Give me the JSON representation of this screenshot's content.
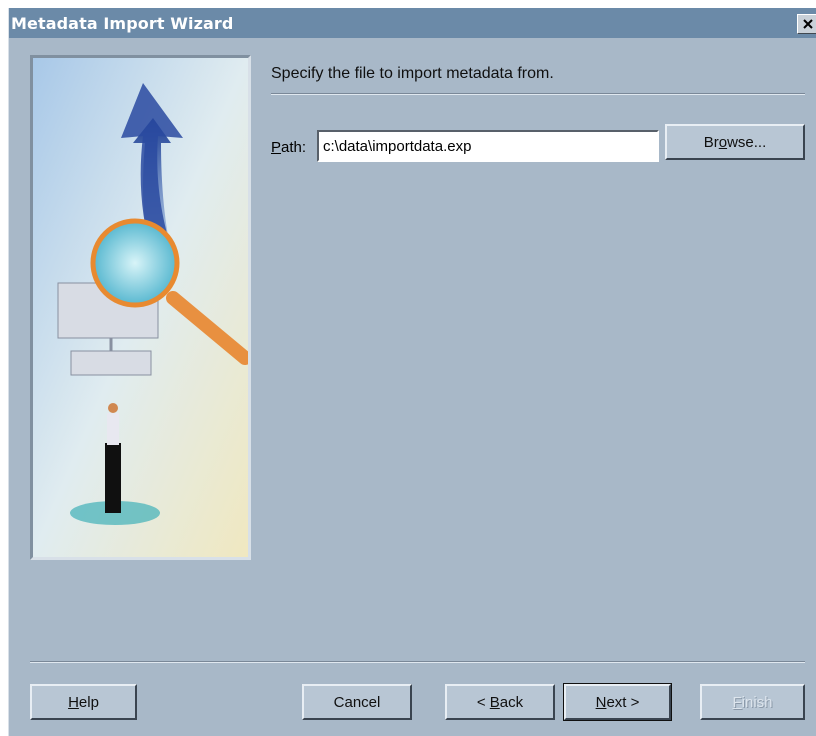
{
  "window": {
    "title": "Metadata Import Wizard",
    "close_label": "Close"
  },
  "main": {
    "instruction": "Specify the file to import metadata from.",
    "path_label_prefix": "P",
    "path_label_rest": "ath:",
    "path_value": "c:\\data\\importdata.exp",
    "browse_prefix": "Br",
    "browse_mnemonic": "o",
    "browse_rest": "wse..."
  },
  "footer": {
    "help_mnemonic": "H",
    "help_rest": "elp",
    "cancel_label": "Cancel",
    "back_prefix": "< ",
    "back_mnemonic": "B",
    "back_rest": "ack",
    "next_mnemonic": "N",
    "next_rest": "ext >",
    "finish_mnemonic": "F",
    "finish_rest": "inish"
  },
  "colors": {
    "title_bar": "#6b8aa8",
    "dialog_bg": "#a8b8c8",
    "button_bg": "#b8c6d4"
  }
}
